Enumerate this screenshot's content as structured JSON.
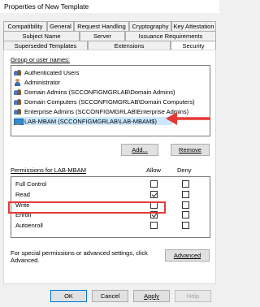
{
  "window": {
    "title": "Properties of New Template"
  },
  "tabs_row1": [
    "Compatibility",
    "General",
    "Request Handling",
    "Cryptography",
    "Key Attestation"
  ],
  "tabs_row2": [
    "Subject Name",
    "Server",
    "Issuance Requirements"
  ],
  "tabs_row3": [
    "Superseded Templates",
    "Extensions",
    "Security"
  ],
  "security": {
    "group_label": "Group or user names:",
    "groups": [
      "Authenticated Users",
      "Administrator",
      "Domain Admins (SCCONFIGMGRLAB\\Domain Admins)",
      "Domain Computers (SCCONFIGMGRLAB\\Domain Computers)",
      "Enterprise Admins (SCCONFIGMGRLAB\\Enterprise Admins)",
      "LAB-MBAM (SCCONFIGMGRLAB\\LAB-MBAM$)"
    ],
    "add_label": "Add...",
    "remove_label": "Remove",
    "perm_label": "Permissions for LAB-MBAM",
    "allow_header": "Allow",
    "deny_header": "Deny",
    "permissions": [
      {
        "name": "Full Control",
        "allow": false,
        "deny": false
      },
      {
        "name": "Read",
        "allow": true,
        "deny": false
      },
      {
        "name": "Write",
        "allow": false,
        "deny": false
      },
      {
        "name": "Enroll",
        "allow": true,
        "deny": false
      },
      {
        "name": "Autoenroll",
        "allow": false,
        "deny": false
      }
    ],
    "special_text_1": "For special permissions or advanced settings, click",
    "special_text_2": "Advanced.",
    "advanced_label": "Advanced"
  },
  "footer": {
    "ok": "OK",
    "cancel": "Cancel",
    "apply": "Apply",
    "help": "Help"
  },
  "colors": {
    "highlight": "#e53935",
    "selection": "#cce8ff",
    "accent": "#0078d7"
  },
  "icons": [
    "users-icon",
    "user-icon",
    "computer-icon",
    "red-arrow"
  ]
}
